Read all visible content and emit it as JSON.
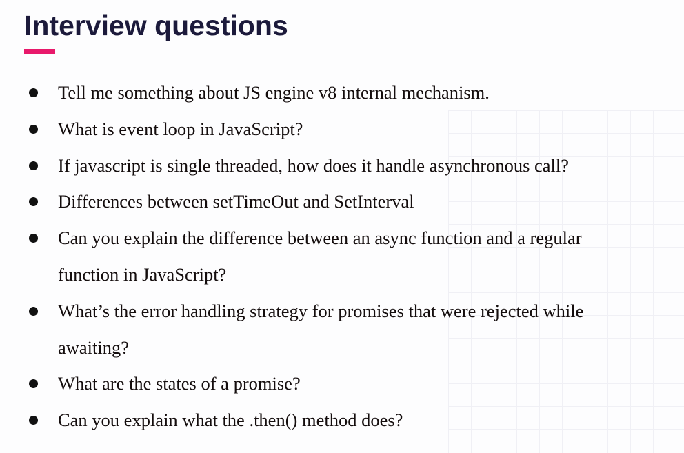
{
  "title": "Interview questions",
  "colors": {
    "accent": "#e8196b",
    "title": "#1c1a3b"
  },
  "questions": [
    "Tell me something about JS engine v8 internal mechanism.",
    "What is event loop in JavaScript?",
    "If javascript is single threaded, how does it handle asynchronous call?",
    "Differences between setTimeOut and SetInterval",
    "Can you explain the difference between an async function and a regular function in JavaScript?",
    "What’s the error handling strategy for promises that were rejected while awaiting?",
    "What are the states of a promise?",
    "Can you explain what the .then() method does?"
  ]
}
